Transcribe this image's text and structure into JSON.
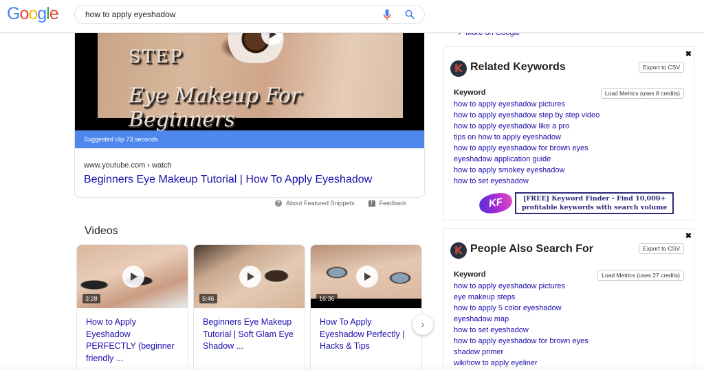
{
  "header": {
    "logo_letters": [
      {
        "char": "G",
        "color": "#4285F4"
      },
      {
        "char": "o",
        "color": "#EA4335"
      },
      {
        "char": "o",
        "color": "#FBBC05"
      },
      {
        "char": "g",
        "color": "#4285F4"
      },
      {
        "char": "l",
        "color": "#34A853"
      },
      {
        "char": "e",
        "color": "#EA4335"
      }
    ],
    "search_query": "how to apply eyeshadow",
    "mic_icon": "microphone-icon",
    "search_icon": "magnifier-icon"
  },
  "featured_snippet": {
    "thumbnail_text_top": "STEP",
    "thumbnail_text_main": "Eye Makeup For Beginners",
    "clip_label": "Suggested clip 73 seconds",
    "url": "www.youtube.com › watch",
    "title": "Beginners Eye Makeup Tutorial | How To Apply Eyeshadow",
    "footer": {
      "about_label": "About Featured Snippets",
      "feedback_label": "Feedback"
    }
  },
  "videos": {
    "heading": "Videos",
    "items": [
      {
        "duration": "3:28",
        "title": "How to Apply Eyeshadow PERFECTLY (beginner friendly ..."
      },
      {
        "duration": "5:46",
        "title": "Beginners Eye Makeup Tutorial | Soft Glam Eye Shadow ..."
      },
      {
        "duration": "16:36",
        "title": "How To Apply Eyeshadow Perfectly | Hacks & Tips"
      }
    ],
    "next_icon": "›"
  },
  "right_panel": {
    "more_on_google": "More on Google",
    "related": {
      "logo_letter": "K",
      "title": "Related Keywords",
      "export_label": "Export to CSV",
      "close_label": "✖",
      "keyword_header": "Keyword",
      "load_metrics_label": "Load Metrics (uses 8 credits)",
      "keywords": [
        "how to apply eyeshadow pictures",
        "how to apply eyeshadow step by step video",
        "how to apply eyeshadow like a pro",
        "tips on how to apply eyeshadow",
        "how to apply eyeshadow for brown eyes",
        "eyeshadow application guide",
        "how to apply smokey eyeshadow",
        "how to set eyeshadow"
      ],
      "promo": {
        "logo_text": "KF",
        "line1": "[FREE] Keyword Finder - Find 10,000+",
        "line2": "profitable  keywords with search volume"
      }
    },
    "people_also": {
      "logo_letter": "K",
      "title": "People Also Search For",
      "export_label": "Export to CSV",
      "close_label": "✖",
      "keyword_header": "Keyword",
      "load_metrics_label": "Load Metrics (uses 27 credits)",
      "keywords": [
        "how to apply eyeshadow pictures",
        "eye makeup steps",
        "how to apply 5 color eyeshadow",
        "eyeshadow map",
        "how to set eyeshadow",
        "how to apply eyeshadow for brown eyes",
        "shadow primer",
        "wikihow to apply eyeliner"
      ]
    }
  },
  "colors": {
    "link": "#1a0dab",
    "clip_bar": "#4f87ec",
    "k_logo_bg": "#27323f",
    "k_logo_fg": "#c4473a"
  }
}
